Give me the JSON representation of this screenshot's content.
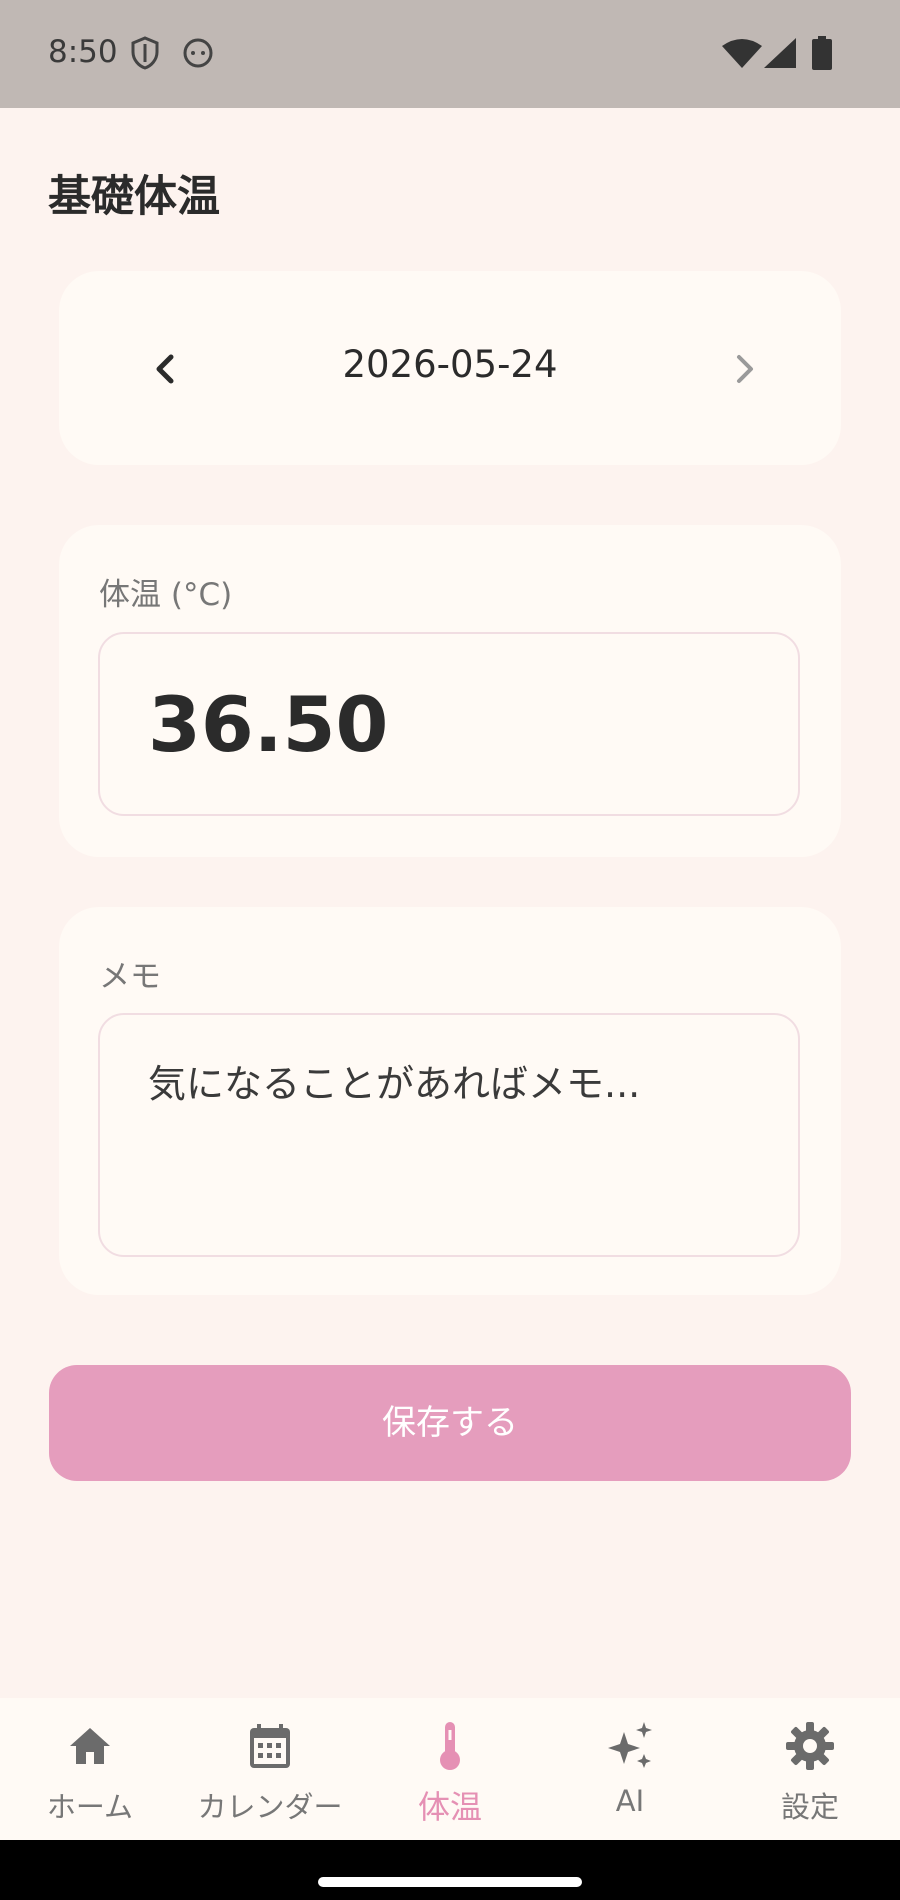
{
  "status_bar": {
    "time": "8:50"
  },
  "header": {
    "title": "基礎体温"
  },
  "date_selector": {
    "date": "2026-05-24"
  },
  "temperature": {
    "label": "体温 (°C)",
    "value": "36.50"
  },
  "memo": {
    "label": "メモ",
    "placeholder": "気になることがあればメモ..."
  },
  "actions": {
    "save_label": "保存する"
  },
  "bottom_nav": {
    "items": [
      {
        "label": "ホーム",
        "icon": "home-icon"
      },
      {
        "label": "カレンダー",
        "icon": "calendar-icon"
      },
      {
        "label": "体温",
        "icon": "thermometer-icon",
        "active": true
      },
      {
        "label": "AI",
        "icon": "sparkle-icon"
      },
      {
        "label": "設定",
        "icon": "gear-icon"
      }
    ]
  },
  "colors": {
    "background": "#fdf3ef",
    "card": "#fffaf5",
    "accent": "#e59dbd",
    "accent_text": "#e590b4",
    "status_bar": "#c0b8b4"
  }
}
